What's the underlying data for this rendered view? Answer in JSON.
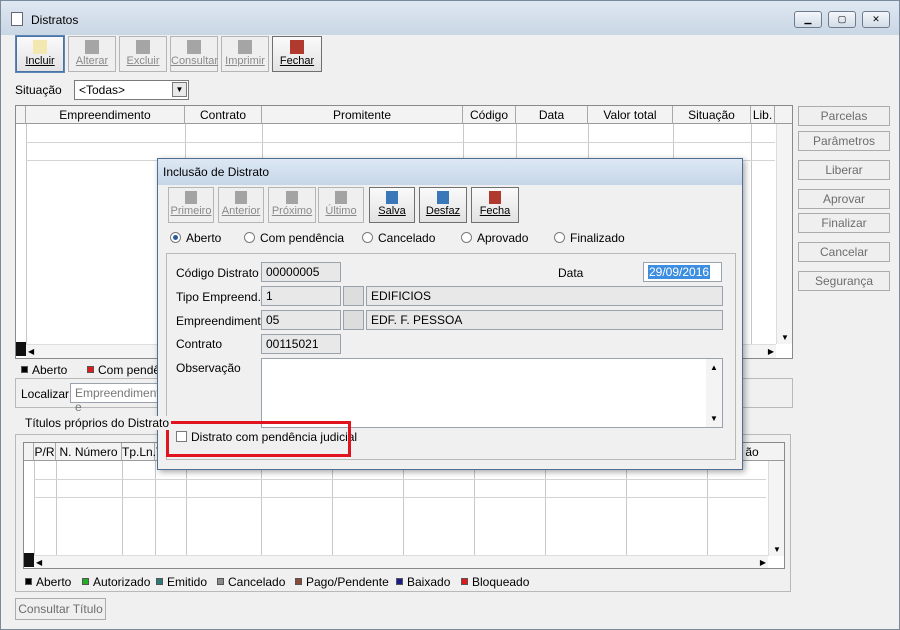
{
  "window": {
    "title": "Distratos"
  },
  "toolbar": [
    {
      "label": "Incluir",
      "enabled": true,
      "selected": true
    },
    {
      "label": "Alterar",
      "enabled": false
    },
    {
      "label": "Excluir",
      "enabled": false
    },
    {
      "label": "Consultar",
      "enabled": false
    },
    {
      "label": "Imprimir",
      "enabled": false
    },
    {
      "label": "Fechar",
      "enabled": true
    }
  ],
  "filter": {
    "label": "Situação",
    "value": "<Todas>"
  },
  "grid1": {
    "columns": [
      "Empreendimento",
      "Contrato",
      "Promitente",
      "Código",
      "Data",
      "Valor total",
      "Situação",
      "Lib."
    ]
  },
  "right_buttons": [
    "Parcelas",
    "Parâmetros",
    "Liberar",
    "Aprovar",
    "Finalizar",
    "Cancelar",
    "Segurança"
  ],
  "legend1": [
    "Aberto",
    "Com pendê"
  ],
  "localizar": {
    "label": "Localizar",
    "placeholder": "Empreendimento e"
  },
  "titulos_label": "Títulos próprios do Distrato",
  "grid2": {
    "columns": [
      "P/R",
      "N. Número",
      "Tp.Ln.T"
    ],
    "tail_column": "ão"
  },
  "legend2": [
    {
      "label": "Aberto",
      "color": "#000000"
    },
    {
      "label": "Autorizado",
      "color": "#22b022"
    },
    {
      "label": "Emitido",
      "color": "#2a7a7a"
    },
    {
      "label": "Cancelado",
      "color": "#8a8a8a"
    },
    {
      "label": "Pago/Pendente",
      "color": "#8a4a3a"
    },
    {
      "label": "Baixado",
      "color": "#1a1a8a"
    },
    {
      "label": "Bloqueado",
      "color": "#e01a1a"
    }
  ],
  "consultar_titulo": "Consultar Título",
  "dialog": {
    "title": "Inclusão de Distrato",
    "nav_buttons": [
      {
        "label": "Primeiro",
        "enabled": false
      },
      {
        "label": "Anterior",
        "enabled": false
      },
      {
        "label": "Próximo",
        "enabled": false
      },
      {
        "label": "Último",
        "enabled": false
      },
      {
        "label": "Salva",
        "enabled": true
      },
      {
        "label": "Desfaz",
        "enabled": true
      },
      {
        "label": "Fecha",
        "enabled": true
      }
    ],
    "status_options": [
      "Aberto",
      "Com pendência",
      "Cancelado",
      "Aprovado",
      "Finalizado"
    ],
    "status_selected": "Aberto",
    "fields": {
      "codigo_label": "Código Distrato",
      "codigo_value": "00000005",
      "data_label": "Data",
      "data_value": "29/09/2016",
      "tipo_label": "Tipo Empreend.",
      "tipo_code": "1",
      "tipo_desc": "EDIFICIOS",
      "emp_label": "Empreendimento",
      "emp_code": "05",
      "emp_desc": "EDF. F. PESSOA",
      "contrato_label": "Contrato",
      "contrato_value": "00115021",
      "obs_label": "Observação"
    },
    "checkbox_label": "Distrato com pendência judicial",
    "checkbox_checked": false
  }
}
